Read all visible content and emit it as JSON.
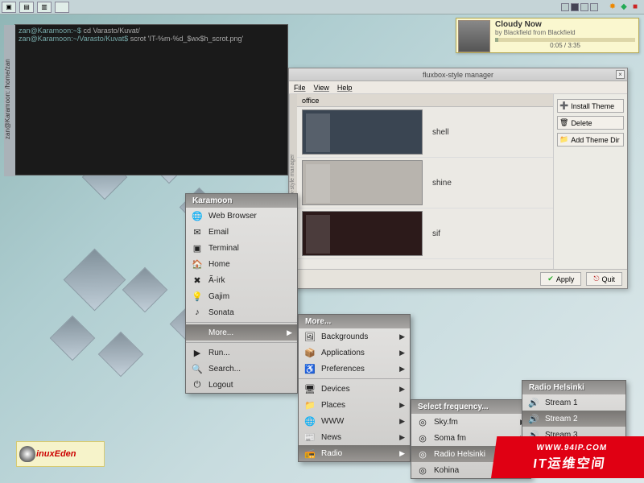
{
  "terminal": {
    "title": "zan@Karamoon: /home/zan",
    "l1_prompt": "zan@Karamoon:~$ ",
    "l1_cmd": "cd Varasto/Kuvat/",
    "l2_prompt": "zan@Karamoon:~/Varasto/Kuvat$ ",
    "l2_cmd": "scrot 'IT-%m-%d_$wx$h_scrot.png'"
  },
  "music": {
    "title": "Cloudy Now",
    "artist": "by Blackfield from Blackfield",
    "elapsed": "0:05",
    "total": "3:35",
    "percent": 2.5
  },
  "stylemgr": {
    "title": "fluxbox-style manager",
    "menu": {
      "file": "File",
      "view": "View",
      "help": "Help"
    },
    "tab": "office",
    "themes": [
      {
        "name": "shell"
      },
      {
        "name": "shine"
      },
      {
        "name": "sif"
      }
    ],
    "buttons": {
      "install": "Install Theme",
      "delete": "Delete",
      "addDir": "Add Theme Dir",
      "apply": "Apply",
      "quit": "Quit"
    },
    "sidebar": "fluxbox-style manager"
  },
  "mainmenu": {
    "title": "Karamoon",
    "items": [
      {
        "label": "Web Browser",
        "icon": "🌐"
      },
      {
        "label": "Email",
        "icon": "✉"
      },
      {
        "label": "Terminal",
        "icon": "▣"
      },
      {
        "label": "Home",
        "icon": "🏠"
      },
      {
        "label": "Ã-irk",
        "icon": "✖"
      },
      {
        "label": "Gajim",
        "icon": "💡"
      },
      {
        "label": "Sonata",
        "icon": "♪"
      },
      {
        "label": "More...",
        "icon": "",
        "sub": true,
        "hl": true
      },
      {
        "label": "Run...",
        "icon": "▶"
      },
      {
        "label": "Search...",
        "icon": "🔍"
      },
      {
        "label": "Logout",
        "icon": "⏻"
      }
    ]
  },
  "moremenu": {
    "title": "More...",
    "items": [
      {
        "label": "Backgrounds",
        "icon": "🖼",
        "sub": true
      },
      {
        "label": "Applications",
        "icon": "📦",
        "sub": true
      },
      {
        "label": "Preferences",
        "icon": "♿",
        "sub": true
      },
      {
        "label": "Devices",
        "icon": "🖥",
        "sub": true
      },
      {
        "label": "Places",
        "icon": "📁",
        "sub": true
      },
      {
        "label": "WWW",
        "icon": "🌐",
        "sub": true
      },
      {
        "label": "News",
        "icon": "📰",
        "sub": true
      },
      {
        "label": "Radio",
        "icon": "📻",
        "sub": true,
        "hl": true
      }
    ]
  },
  "radiomenu": {
    "title": "Select frequency...",
    "items": [
      {
        "label": "Sky.fm",
        "icon": "◎",
        "sub": true
      },
      {
        "label": "Soma fm",
        "icon": "◎",
        "sub": true
      },
      {
        "label": "Radio Helsinki",
        "icon": "◎",
        "sub": true,
        "hl": true
      },
      {
        "label": "Kohina",
        "icon": "◎",
        "sub": true
      }
    ]
  },
  "helsinkimenu": {
    "title": "Radio Helsinki",
    "items": [
      {
        "label": "Stream 1",
        "icon": "🔊"
      },
      {
        "label": "Stream 2",
        "icon": "🔊",
        "hl": true
      },
      {
        "label": "Stream 3",
        "icon": "🔊"
      }
    ]
  },
  "logos": {
    "linuxeden": "inuxEden",
    "redUrl": "WWW.94IP.COM",
    "redText": "IT运维空间"
  }
}
